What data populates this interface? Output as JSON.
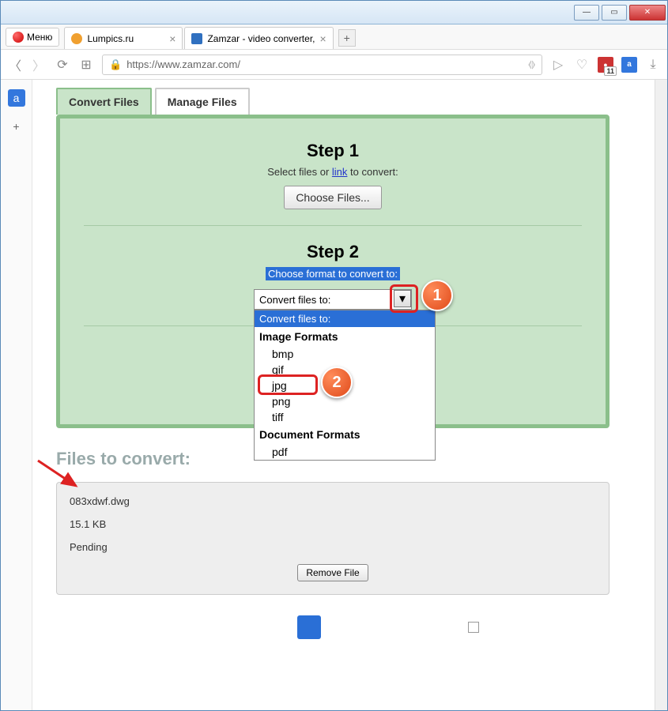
{
  "window": {
    "menu": "Меню"
  },
  "tabs": [
    {
      "title": "Lumpics.ru",
      "favicon_color": "#f0a030"
    },
    {
      "title": "Zamzar - video converter,",
      "favicon_color": "#3070c0"
    }
  ],
  "addressbar": {
    "url": "https://www.zamzar.com/"
  },
  "ext_badge": "11",
  "card_tabs": {
    "active": "Convert Files",
    "inactive": "Manage Files"
  },
  "step1": {
    "title": "Step 1",
    "text_before": "Select files or ",
    "link": "link",
    "text_after": " to convert:",
    "button": "Choose Files..."
  },
  "step2": {
    "title": "Step 2",
    "subtitle": "Choose format to convert to:",
    "select_label": "Convert files to:"
  },
  "dropdown": {
    "header": "Convert files to:",
    "group1": "Image Formats",
    "items1": [
      "bmp",
      "gif",
      "jpg",
      "png",
      "tiff"
    ],
    "group2": "Document Formats",
    "items2": [
      "pdf"
    ]
  },
  "step3_hint": ")",
  "files_section": {
    "title": "Files to convert:"
  },
  "file": {
    "name": "083xdwf.dwg",
    "size": "15.1 KB",
    "status": "Pending",
    "remove": "Remove File"
  },
  "callouts": {
    "one": "1",
    "two": "2"
  }
}
